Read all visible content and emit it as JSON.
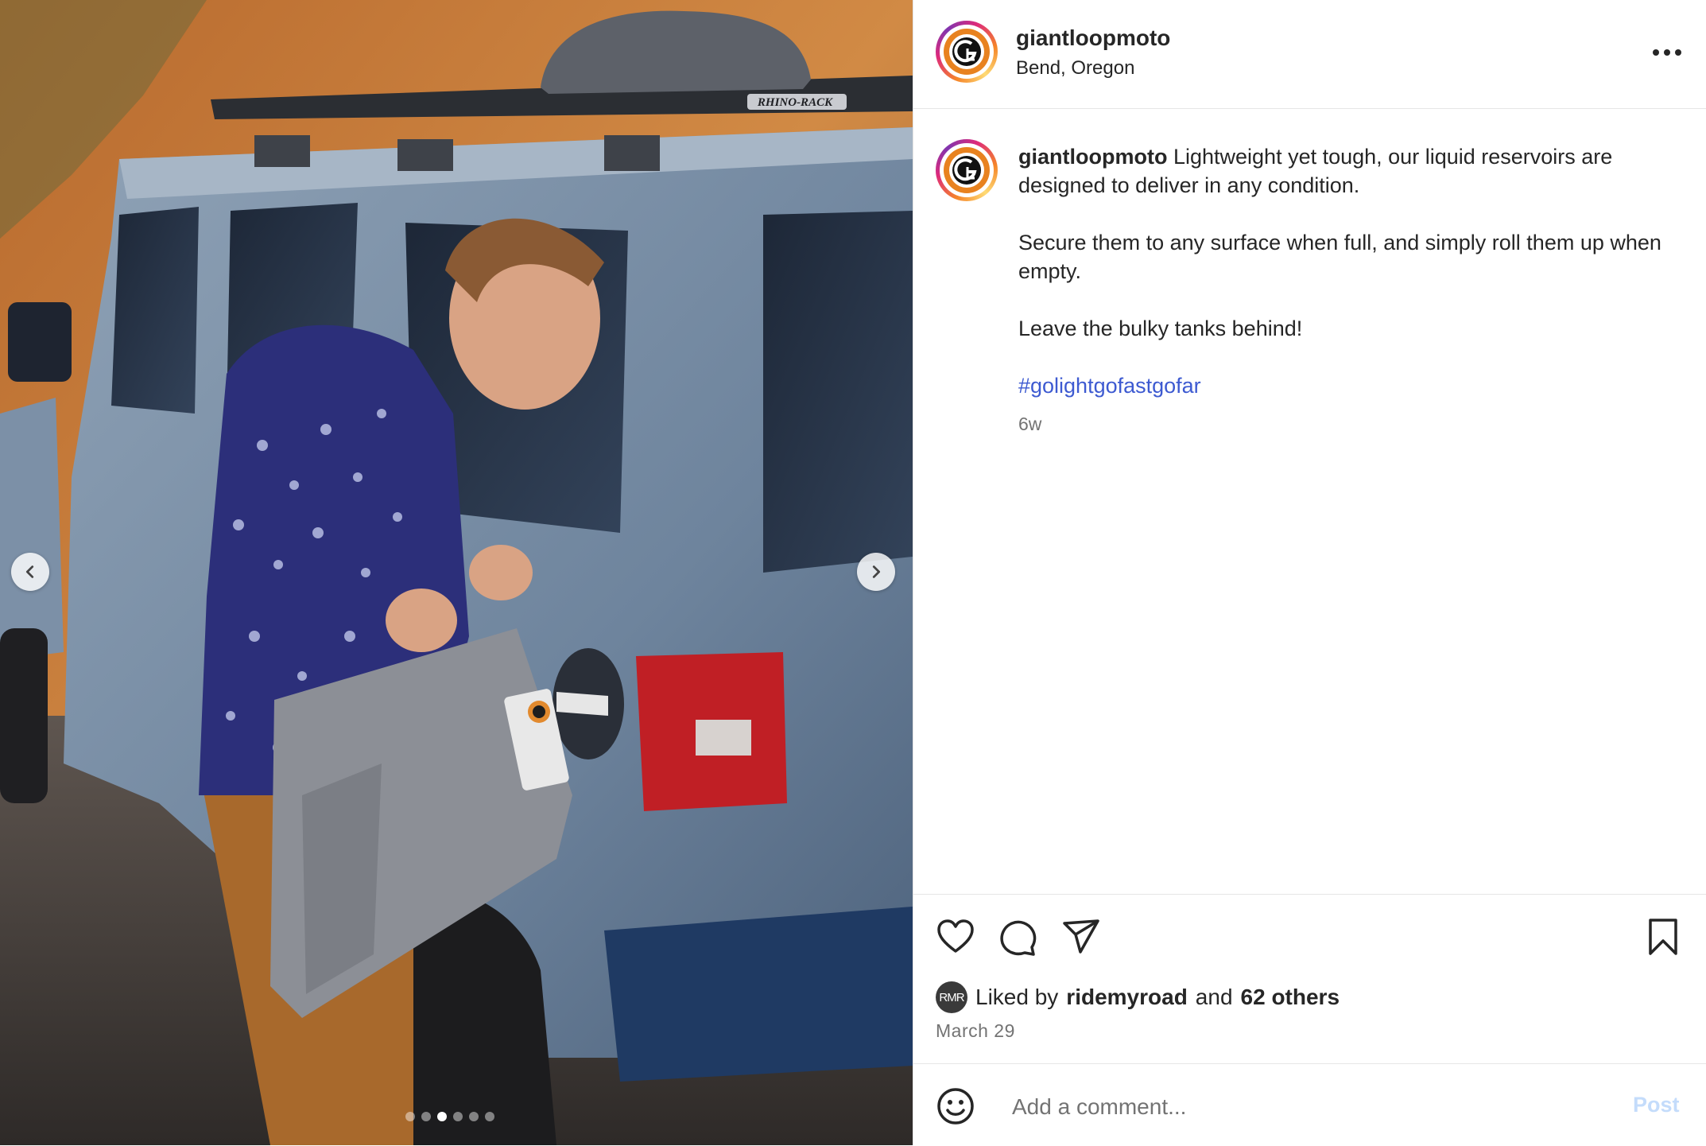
{
  "media": {
    "roof_rack_brand": "RHINO-RACK",
    "prev_icon": "chevron-left-icon",
    "next_icon": "chevron-right-icon",
    "carousel": {
      "count": 6,
      "active_index": 2
    }
  },
  "header": {
    "username": "giantloopmoto",
    "location": "Bend, Oregon",
    "more_icon": "more-options-icon"
  },
  "caption": {
    "username": "giantloopmoto",
    "line1": "Lightweight yet tough, our liquid reservoirs are designed to deliver in any condition.",
    "line2": "Secure them to any surface when full, and simply roll them up when empty.",
    "line3": "Leave the bulky tanks behind!",
    "hashtag": "#golightgofastgofar",
    "age": "6w"
  },
  "actions": {
    "like_icon": "heart-icon",
    "comment_icon": "comment-icon",
    "share_icon": "send-icon",
    "save_icon": "bookmark-icon"
  },
  "likes": {
    "avatar_initials": "RMR",
    "prefix": "Liked by",
    "liker": "ridemyroad",
    "conjunction": "and",
    "others": "62 others"
  },
  "date": "March 29",
  "comment": {
    "placeholder": "Add a comment...",
    "post_label": "Post",
    "emoji_icon": "smiley-icon"
  },
  "colors": {
    "hashtag": "#3d5ad1",
    "post_disabled": "#c4dcfb",
    "muted_text": "#737373"
  }
}
